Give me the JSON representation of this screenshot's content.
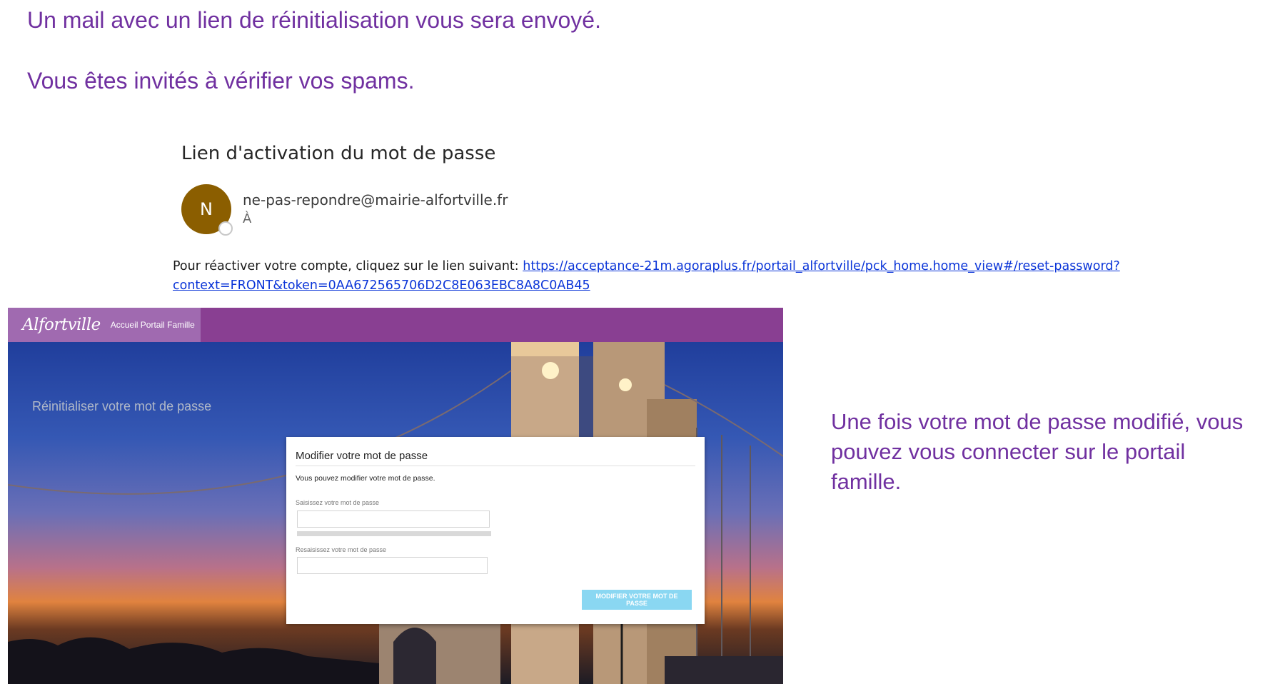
{
  "intro": {
    "line1": "Un mail avec un lien de réinitialisation vous sera envoyé.",
    "line2": "Vous êtes invités à vérifier vos spams."
  },
  "email": {
    "subject": "Lien d'activation du mot de passe",
    "avatar_initial": "N",
    "sender": "ne-pas-repondre@mairie-alfortville.fr",
    "recipient_label": "À",
    "body_text": "Pour réactiver votre compte, cliquez sur le lien suivant: ",
    "link": "https://acceptance-21m.agoraplus.fr/portail_alfortville/pck_home.home_view#/reset-password?context=FRONT&token=0AA672565706D2C8E063EBC8A8C0AB45",
    "avatar_color": "#8b5e00",
    "link_color": "#0b35d8"
  },
  "portal": {
    "logo_text": "Alfortville",
    "home_link": "Accueil Portail Famille",
    "page_heading": "Réinitialiser votre mot de passe",
    "header_color": "#893f92",
    "dialog": {
      "title": "Modifier votre mot de passe",
      "description": "Vous pouvez modifier votre mot de passe.",
      "field1_label": "Saisissez votre mot de passe",
      "field1_value": "",
      "field2_label": "Resaisissez votre mot de passe",
      "field2_value": "",
      "submit_label": "MODIFIER VOTRE MOT DE PASSE",
      "submit_color": "#8ad7f2"
    }
  },
  "outro": "Une fois votre mot de passe modifié, vous pouvez vous connecter sur le portail famille.",
  "text_color": "#7030a0"
}
